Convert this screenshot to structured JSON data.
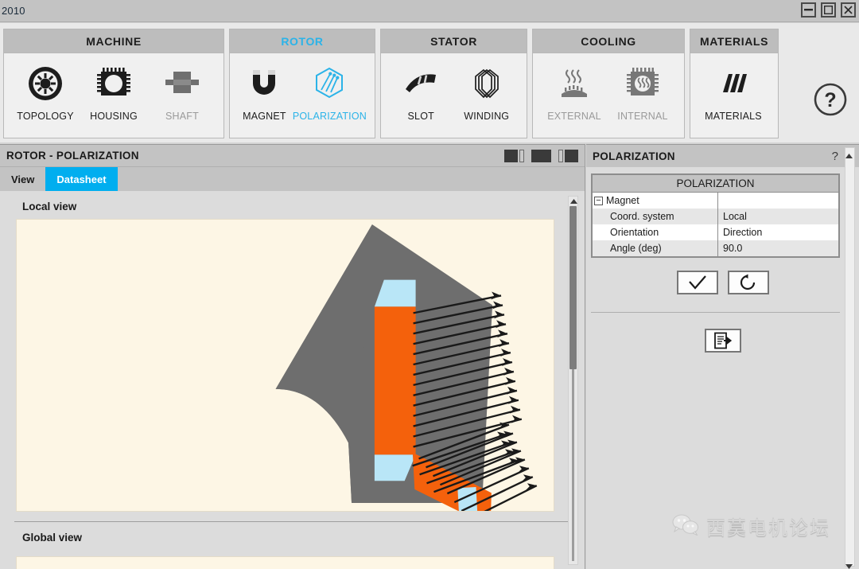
{
  "window": {
    "title": "2010",
    "controls": [
      {
        "name": "minimize",
        "glyph": "minimize-icon"
      },
      {
        "name": "maximize",
        "glyph": "maximize-icon"
      },
      {
        "name": "close",
        "glyph": "close-icon"
      }
    ]
  },
  "colors": {
    "accent": "#00aeef",
    "ribbon_accent": "#2bb3e8",
    "header_gray": "#c3c3c3",
    "panel_gray": "#dcdcdc",
    "magnet_orange": "#f4610c",
    "rotor_gray": "#6e6e6e",
    "air_blue": "#b9e6f7",
    "canvas_cream": "#fdf6e5"
  },
  "ribbon": {
    "groups": [
      {
        "title": "MACHINE",
        "accent": false,
        "items": [
          {
            "label": "TOPOLOGY",
            "icon": "topology-icon",
            "state": "enabled"
          },
          {
            "label": "HOUSING",
            "icon": "housing-icon",
            "state": "enabled"
          },
          {
            "label": "SHAFT",
            "icon": "shaft-icon",
            "state": "disabled"
          }
        ]
      },
      {
        "title": "ROTOR",
        "accent": true,
        "items": [
          {
            "label": "MAGNET",
            "icon": "magnet-icon",
            "state": "enabled"
          },
          {
            "label": "POLARIZATION",
            "icon": "polarization-icon",
            "state": "active"
          }
        ]
      },
      {
        "title": "STATOR",
        "accent": false,
        "items": [
          {
            "label": "SLOT",
            "icon": "slot-icon",
            "state": "enabled"
          },
          {
            "label": "WINDING",
            "icon": "winding-icon",
            "state": "enabled"
          }
        ]
      },
      {
        "title": "COOLING",
        "accent": false,
        "items": [
          {
            "label": "EXTERNAL",
            "icon": "external-cooling-icon",
            "state": "disabled"
          },
          {
            "label": "INTERNAL",
            "icon": "internal-cooling-icon",
            "state": "disabled"
          }
        ]
      },
      {
        "title": "MATERIALS",
        "accent": false,
        "items": [
          {
            "label": "MATERIALS",
            "icon": "materials-icon",
            "state": "enabled"
          }
        ]
      }
    ],
    "help_icon": "help-circle-icon"
  },
  "left_panel": {
    "title": "ROTOR - POLARIZATION",
    "layout_buttons": [
      {
        "name": "split-left-icon"
      },
      {
        "name": "full-icon"
      },
      {
        "name": "split-right-icon"
      }
    ],
    "tabs": [
      {
        "label": "View",
        "active": false
      },
      {
        "label": "Datasheet",
        "active": true
      }
    ],
    "local_view_label": "Local view",
    "global_view_label": "Global view"
  },
  "right_panel": {
    "title": "POLARIZATION",
    "help_glyph": "?",
    "grid": {
      "title": "POLARIZATION",
      "group_label": "Magnet",
      "group_toggle": "−",
      "rows": [
        {
          "key": "Coord. system",
          "value": "Local"
        },
        {
          "key": "Orientation",
          "value": "Direction"
        },
        {
          "key": "Angle (deg)",
          "value": "90.0"
        }
      ]
    },
    "buttons": [
      {
        "name": "validate-button",
        "icon": "check-icon"
      },
      {
        "name": "reset-button",
        "icon": "reset-arrow-icon"
      }
    ],
    "export_button": {
      "name": "export-button",
      "icon": "document-export-icon"
    }
  },
  "watermark": {
    "text": "西莫电机论坛",
    "icon": "wechat-icon"
  },
  "diagram": {
    "description": "Rotor pole segment with two orange magnets, light-blue air pockets and black polarization direction arrows",
    "magnet_count": 2,
    "arrow_count_magnet_1": 14,
    "arrow_count_magnet_2": 12,
    "polarization_angle_deg": 90.0
  }
}
